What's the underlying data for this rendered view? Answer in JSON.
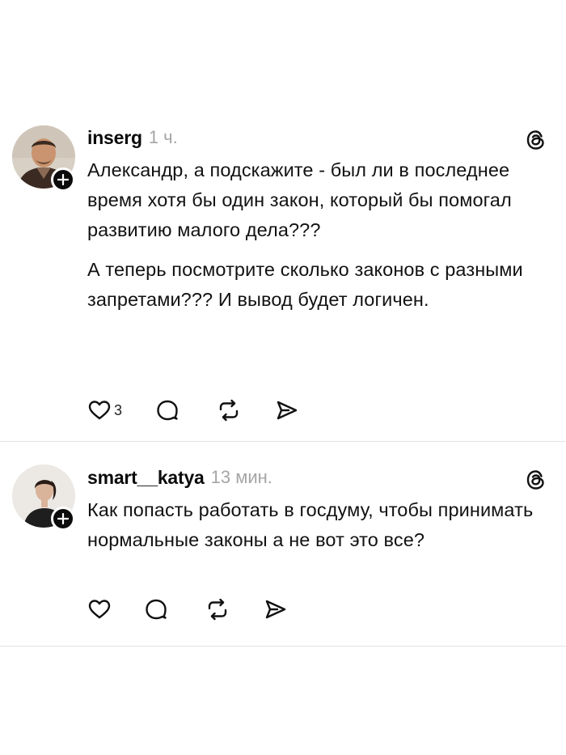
{
  "posts": [
    {
      "username": "inserg",
      "time": "1 ч.",
      "paragraphs": [
        "Александр, а подскажите - был ли в последнее время хотя бы один закон, который бы помогал развитию малого дела???",
        "А теперь посмотрите сколько законов с разными запретами??? И вывод будет логичен."
      ],
      "likes": "3",
      "icons": [
        "heart-icon",
        "comment-icon",
        "repost-icon",
        "share-icon",
        "threads-logo-icon"
      ]
    },
    {
      "username": "smart__katya",
      "time": "13 мин.",
      "paragraphs": [
        "Как попасть работать в госдуму, чтобы принимать нормальные законы а не вот это все?"
      ],
      "likes": "",
      "icons": [
        "heart-icon",
        "comment-icon",
        "repost-icon",
        "share-icon",
        "threads-logo-icon"
      ]
    }
  ]
}
